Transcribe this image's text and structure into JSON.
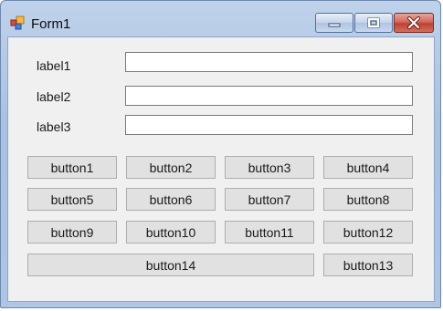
{
  "window": {
    "title": "Form1",
    "controls": {
      "minimize_icon": "minimize-icon",
      "maximize_icon": "maximize-icon",
      "close_icon": "close-icon"
    }
  },
  "form": {
    "labels": [
      "label1",
      "label2",
      "label3"
    ],
    "textboxes": [
      "",
      "",
      ""
    ],
    "buttons": [
      "button1",
      "button2",
      "button3",
      "button4",
      "button5",
      "button6",
      "button7",
      "button8",
      "button9",
      "button10",
      "button11",
      "button12",
      "button14",
      "button13"
    ]
  },
  "colors": {
    "close_button": "#c7463a",
    "client_background": "#f0f0f0",
    "button_face": "#e1e1e1"
  }
}
